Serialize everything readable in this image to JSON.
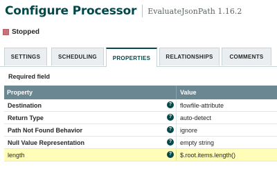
{
  "header": {
    "title": "Configure Processor",
    "subtitle": "EvaluateJsonPath 1.16.2"
  },
  "status": {
    "icon": "stop-icon",
    "label": "Stopped",
    "color": "#c7737b"
  },
  "tabs": [
    {
      "label": "SETTINGS",
      "active": false
    },
    {
      "label": "SCHEDULING",
      "active": false
    },
    {
      "label": "PROPERTIES",
      "active": true
    },
    {
      "label": "RELATIONSHIPS",
      "active": false
    },
    {
      "label": "COMMENTS",
      "active": false
    }
  ],
  "required_note": "Required field",
  "table": {
    "headers": {
      "property": "Property",
      "value": "Value"
    },
    "rows": [
      {
        "name": "Destination",
        "value": "flowfile-attribute",
        "help_icon": "question-circle-icon"
      },
      {
        "name": "Return Type",
        "value": "auto-detect",
        "help_icon": "question-circle-icon"
      },
      {
        "name": "Path Not Found Behavior",
        "value": "ignore",
        "help_icon": "question-circle-icon"
      },
      {
        "name": "Null Value Representation",
        "value": "empty string",
        "help_icon": "question-circle-icon"
      },
      {
        "name": "length",
        "value": "$.root.items.length()",
        "help_icon": "question-circle-icon",
        "dynamic": true
      }
    ]
  },
  "colors": {
    "accent": "#004849",
    "header_row": "#6b8791",
    "dynamic_row": "#fffdb8"
  }
}
